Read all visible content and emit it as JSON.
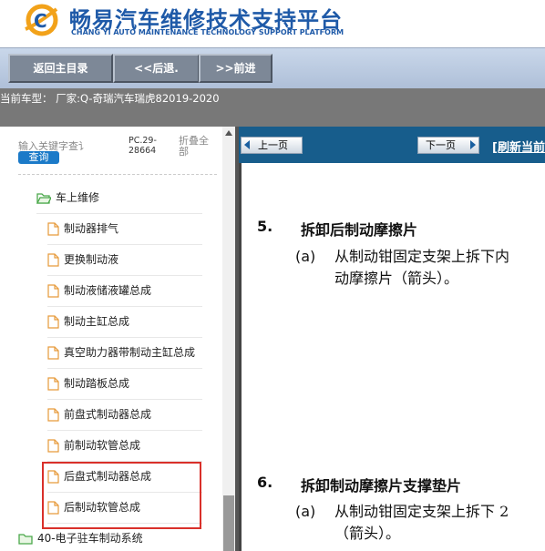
{
  "header": {
    "title": "畅易汽车维修技术支持平台",
    "subtitle": "CHANG YI AUTO MAINTENANCE TECHNOLOGY SUPPORT PLATFORM"
  },
  "nav": {
    "home": "返回主目录",
    "back": "<<后退.",
    "forward": ">>前进"
  },
  "car_info": "当前车型：  厂家:Q-奇瑞汽车瑞虎82019-2020",
  "sidebar": {
    "search_placeholder": "输入关键字查讠",
    "search_button": "查询",
    "pc_info": "PC.29-28664",
    "fold_all": "折叠全部",
    "folder": "车上维修",
    "items": [
      "制动器排气",
      "更换制动液",
      "制动液储液罐总成",
      "制动主缸总成",
      "真空助力器带制动主缸总成",
      "制动踏板总成",
      "前盘式制动器总成",
      "前制动软管总成",
      "后盘式制动器总成",
      "后制动软管总成"
    ],
    "bottom_folder": "40-电子驻车制动系统"
  },
  "content": {
    "prev": "上一页",
    "next": "下一页",
    "refresh": "[刷新当前",
    "steps": [
      {
        "num": "5.",
        "title": "拆卸后制动摩擦片",
        "a": "(a)",
        "line1": "从制动钳固定支架上拆下内",
        "line2": "动摩擦片（箭头）。"
      },
      {
        "num": "6.",
        "title": "拆卸制动摩擦片支撑垫片",
        "a": "(a)",
        "line1": "从制动钳固定支架上拆下 2",
        "line2": "（箭头）。"
      }
    ]
  },
  "colors": {
    "brand_blue": "#1f5aa8",
    "content_header": "#175d8c",
    "highlight_border": "#d9302a"
  }
}
